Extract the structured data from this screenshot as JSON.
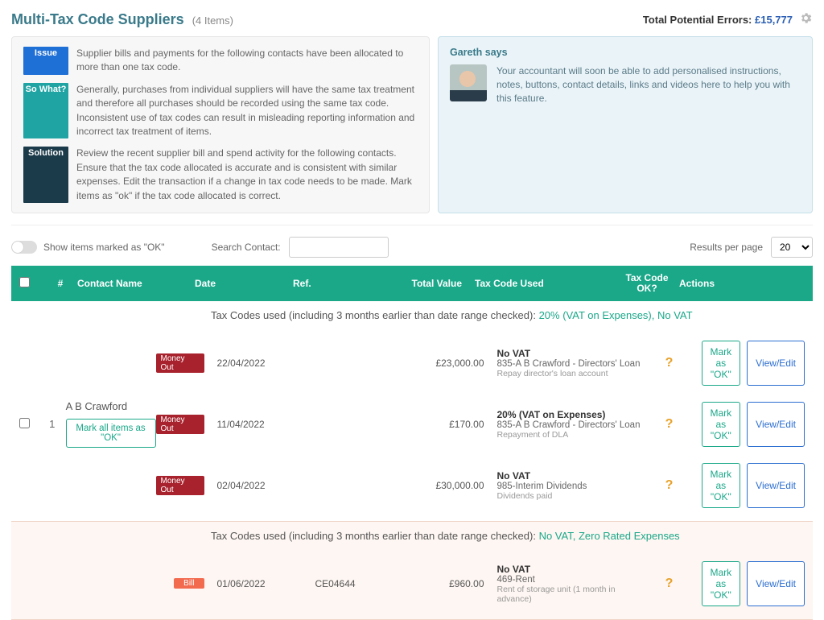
{
  "header": {
    "title": "Multi-Tax Code Suppliers",
    "item_count": "(4 Items)",
    "total_label": "Total Potential Errors: ",
    "total_value": "£15,777"
  },
  "info": {
    "issue_badge": "Issue",
    "issue_text": "Supplier bills and payments for the following contacts have been allocated to more than one tax code.",
    "sowhat_badge": "So What?",
    "sowhat_text": "Generally, purchases from individual suppliers will have the same tax treatment and therefore all purchases should be recorded using the same tax code. Inconsistent use of tax codes can result in misleading reporting information and incorrect tax treatment of items.",
    "solution_badge": "Solution",
    "solution_text": "Review the recent supplier bill and spend activity for the following contacts. Ensure that the tax code allocated is accurate and is consistent with similar expenses. Edit the transaction if a change in tax code needs to be made. Mark items as \"ok\" if the tax code allocated is correct."
  },
  "gareth": {
    "title": "Gareth says",
    "text": "Your accountant will soon be able to add personalised instructions, notes, buttons, contact details, links and videos here to help you with this feature."
  },
  "toolbar": {
    "toggle_label": "Show items marked as \"OK\"",
    "search_label": "Search Contact:",
    "search_value": "",
    "rpp_label": "Results per page",
    "rpp_value": "20"
  },
  "thead": {
    "num": "#",
    "contact": "Contact Name",
    "date": "Date",
    "ref": "Ref.",
    "total": "Total Value",
    "tax": "Tax Code Used",
    "ok": "Tax Code OK?",
    "actions": "Actions"
  },
  "labels": {
    "summary_prefix": "Tax Codes used (including 3 months earlier than date range checked): ",
    "mark_all": "Mark all items as \"OK\"",
    "mark_ok": "Mark as \"OK\"",
    "view_edit": "View/Edit",
    "tag_money_out": "Money Out",
    "tag_bill": "Bill",
    "ok_icon": "?"
  },
  "groups": [
    {
      "num": "1",
      "contact": "A B Crawford",
      "codes": "20% (VAT on Expenses), No VAT",
      "lines": [
        {
          "tag": "money-out",
          "date": "22/04/2022",
          "ref": "",
          "total": "£23,000.00",
          "tax_main": "No VAT",
          "tax_sub": "835-A B Crawford - Directors' Loan",
          "tax_sub2": "Repay director's loan account"
        },
        {
          "tag": "money-out",
          "date": "11/04/2022",
          "ref": "",
          "total": "£170.00",
          "tax_main": "20% (VAT on Expenses)",
          "tax_sub": "835-A B Crawford - Directors' Loan",
          "tax_sub2": "Repayment of DLA"
        },
        {
          "tag": "money-out",
          "date": "02/04/2022",
          "ref": "",
          "total": "£30,000.00",
          "tax_main": "No VAT",
          "tax_sub": "985-Interim Dividends",
          "tax_sub2": "Dividends paid"
        }
      ]
    },
    {
      "num": "",
      "contact": "",
      "codes": "No VAT, Zero Rated Expenses",
      "lines": [
        {
          "tag": "bill",
          "date": "01/06/2022",
          "ref": "CE04644",
          "total": "£960.00",
          "tax_main": "No VAT",
          "tax_sub": "469-Rent",
          "tax_sub2": "Rent of storage unit (1 month in advance)"
        }
      ]
    }
  ]
}
